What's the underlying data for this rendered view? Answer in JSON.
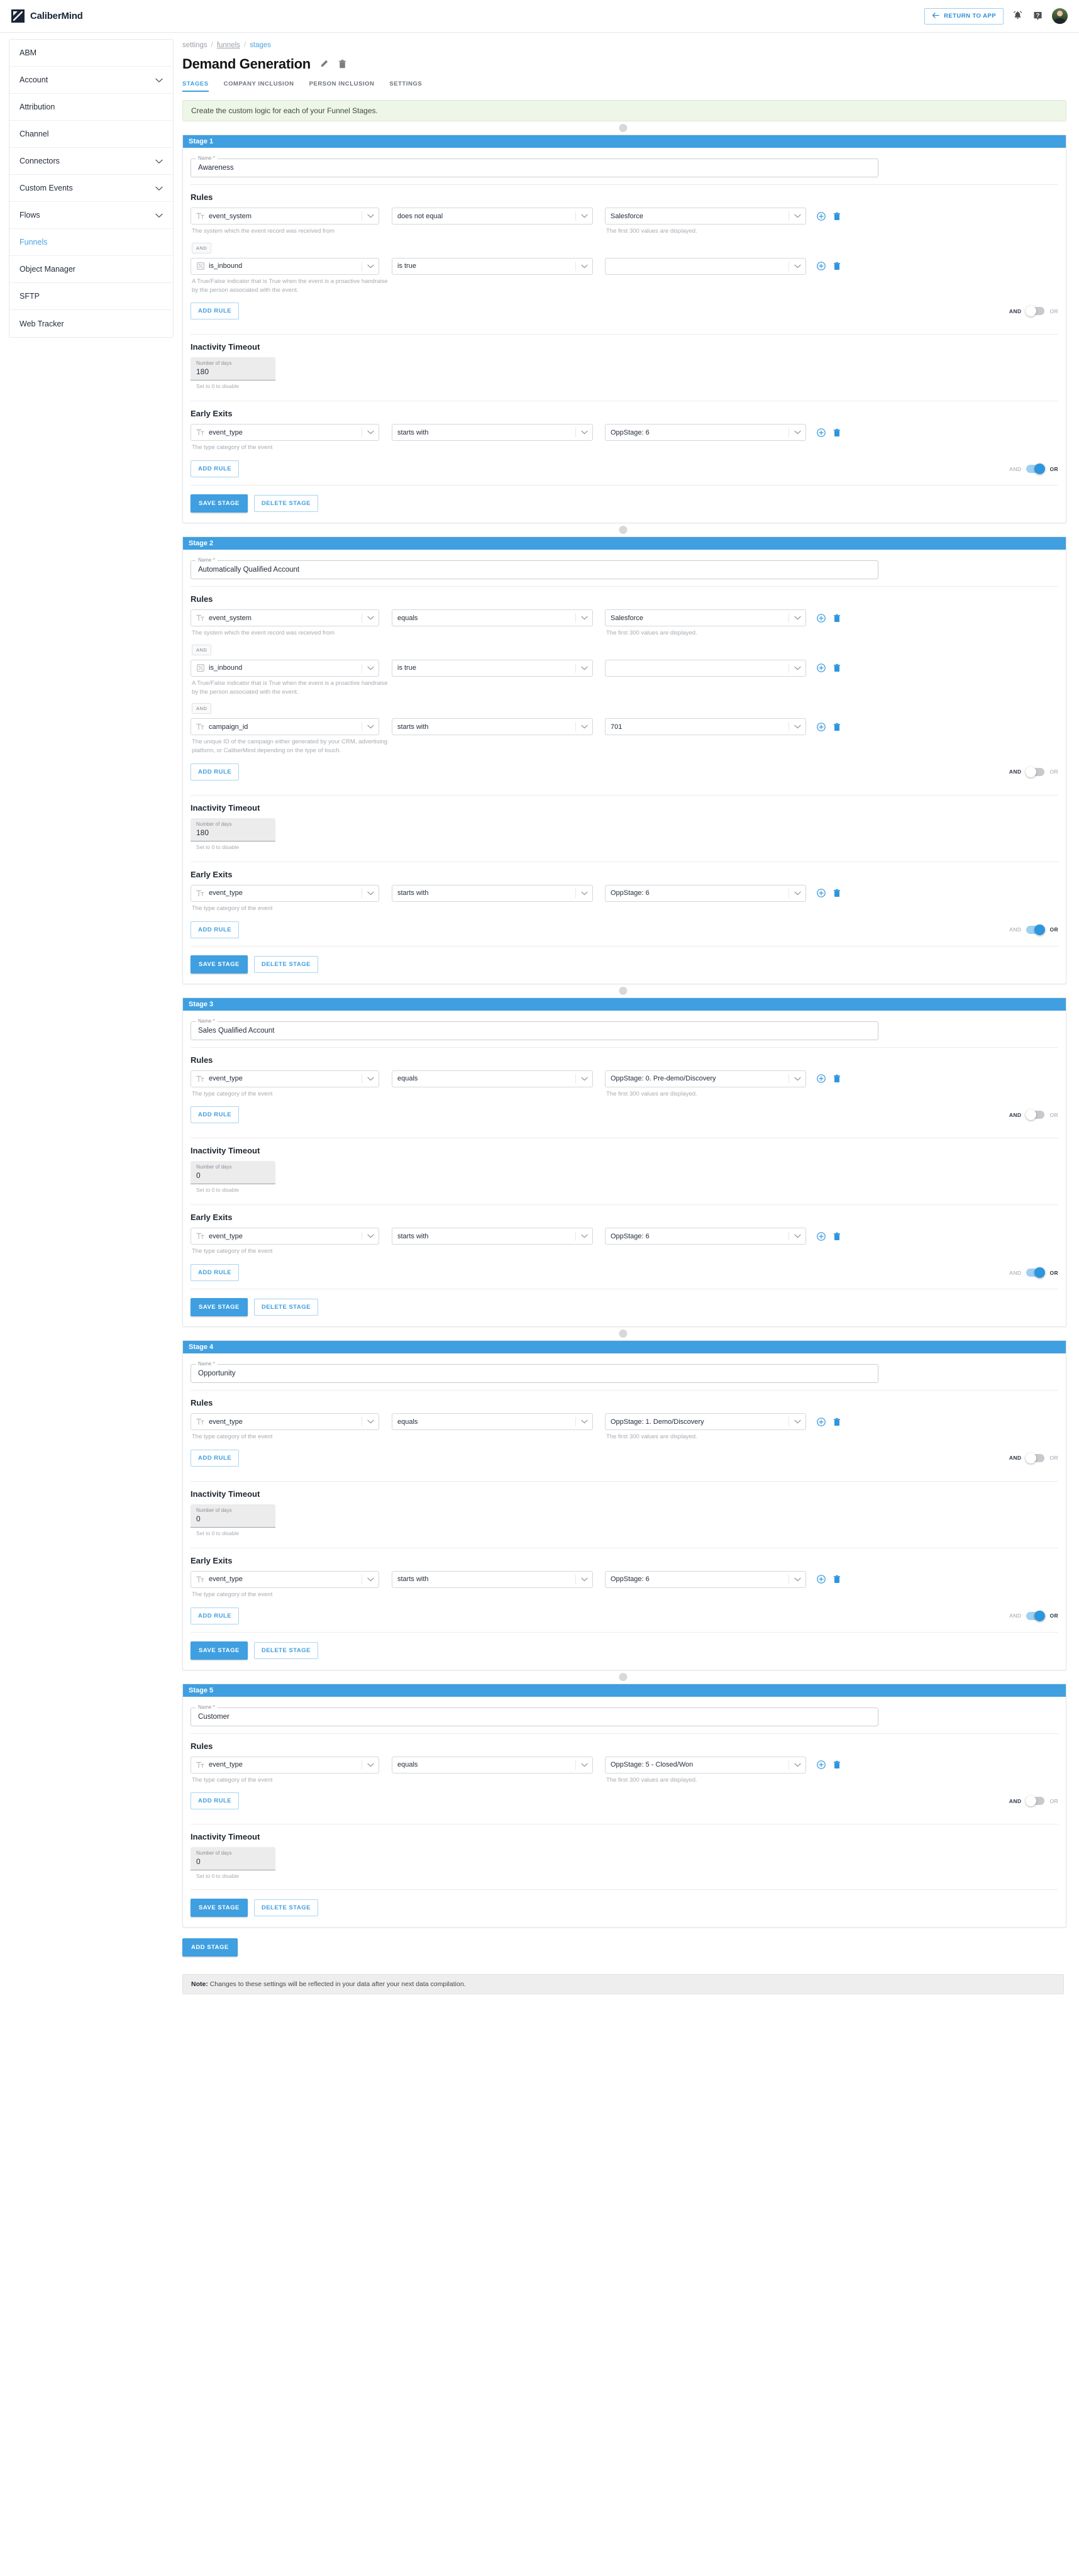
{
  "topbar": {
    "brand": "CaliberMind",
    "return_label": "RETURN TO APP",
    "return_icon": "arrow-left-icon",
    "bell_icon": "notification-bell-icon",
    "help_icon": "help-question-icon",
    "avatar_label": "user-avatar"
  },
  "sidebar": {
    "items": [
      {
        "label": "ABM",
        "expandable": false,
        "active": false
      },
      {
        "label": "Account",
        "expandable": true,
        "active": false
      },
      {
        "label": "Attribution",
        "expandable": false,
        "active": false
      },
      {
        "label": "Channel",
        "expandable": false,
        "active": false
      },
      {
        "label": "Connectors",
        "expandable": true,
        "active": false
      },
      {
        "label": "Custom Events",
        "expandable": true,
        "active": false
      },
      {
        "label": "Flows",
        "expandable": true,
        "active": false
      },
      {
        "label": "Funnels",
        "expandable": false,
        "active": true
      },
      {
        "label": "Object Manager",
        "expandable": false,
        "active": false
      },
      {
        "label": "SFTP",
        "expandable": false,
        "active": false
      },
      {
        "label": "Web Tracker",
        "expandable": false,
        "active": false
      }
    ]
  },
  "breadcrumb": {
    "root": "settings",
    "mid": "funnels",
    "current": "stages",
    "sep": "/"
  },
  "header": {
    "title": "Demand Generation",
    "edit_icon": "pencil-edit-icon",
    "delete_icon": "trash-delete-icon"
  },
  "tabs": [
    {
      "label": "STAGES",
      "active": true
    },
    {
      "label": "COMPANY INCLUSION",
      "active": false
    },
    {
      "label": "PERSON INCLUSION",
      "active": false
    },
    {
      "label": "SETTINGS",
      "active": false
    }
  ],
  "notice": "Create the custom logic for each of your Funnel Stages.",
  "labels": {
    "name_legend": "Name *",
    "rules_title": "Rules",
    "inactivity_title": "Inactivity Timeout",
    "early_exits_title": "Early Exits",
    "add_rule": "ADD RULE",
    "save_stage": "SAVE STAGE",
    "delete_stage": "DELETE STAGE",
    "add_stage": "ADD STAGE",
    "and": "AND",
    "or": "OR",
    "and_chip": "AND",
    "days_label": "Number of days",
    "days_hint": "Set to 0 to disable",
    "value_hint": "The first 300 values are displayed."
  },
  "hints": {
    "event_system": "The system which the event record was received from",
    "is_inbound": "A True/False indicator that is True when the event is a proactive handraise by the person associated with the event.",
    "campaign_id": "The unique ID of the campaign either generated by your CRM, advertising platform, or CaliberMind depending on the type of touch.",
    "event_type": "The type category of the event"
  },
  "footer_note": {
    "bold": "Note:",
    "text": " Changes to these settings will be reflected in your data after your next data compilation."
  },
  "stages": [
    {
      "header": "Stage 1",
      "name": "Awareness",
      "rules": [
        {
          "field": "event_system",
          "field_icon": "text-type-icon",
          "operator": "does not equal",
          "value": "Salesforce",
          "hint": "event_system",
          "show_value_hint": true
        },
        {
          "field": "is_inbound",
          "field_icon": "boolean-type-icon",
          "operator": "is true",
          "value": "",
          "hint": "is_inbound",
          "show_value_hint": false
        }
      ],
      "rules_conjunction": "AND",
      "inactivity_days": "180",
      "early_exits": [
        {
          "field": "event_type",
          "field_icon": "text-type-icon",
          "operator": "starts with",
          "value": "OppStage: 6",
          "hint": "event_type",
          "show_value_hint": false
        }
      ],
      "early_exits_conjunction": "OR"
    },
    {
      "header": "Stage 2",
      "name": "Automatically Qualified Account",
      "rules": [
        {
          "field": "event_system",
          "field_icon": "text-type-icon",
          "operator": "equals",
          "value": "Salesforce",
          "hint": "event_system",
          "show_value_hint": true
        },
        {
          "field": "is_inbound",
          "field_icon": "boolean-type-icon",
          "operator": "is true",
          "value": "",
          "hint": "is_inbound",
          "show_value_hint": false
        },
        {
          "field": "campaign_id",
          "field_icon": "text-type-icon",
          "operator": "starts with",
          "value": "701",
          "hint": "campaign_id",
          "show_value_hint": false
        }
      ],
      "rules_conjunction": "AND",
      "inactivity_days": "180",
      "early_exits": [
        {
          "field": "event_type",
          "field_icon": "text-type-icon",
          "operator": "starts with",
          "value": "OppStage: 6",
          "hint": "event_type",
          "show_value_hint": false
        }
      ],
      "early_exits_conjunction": "OR"
    },
    {
      "header": "Stage 3",
      "name": "Sales Qualified Account",
      "rules": [
        {
          "field": "event_type",
          "field_icon": "text-type-icon",
          "operator": "equals",
          "value": "OppStage: 0. Pre-demo/Discovery",
          "hint": "event_type",
          "show_value_hint": true
        }
      ],
      "rules_conjunction": "AND",
      "inactivity_days": "0",
      "early_exits": [
        {
          "field": "event_type",
          "field_icon": "text-type-icon",
          "operator": "starts with",
          "value": "OppStage: 6",
          "hint": "event_type",
          "show_value_hint": false
        }
      ],
      "early_exits_conjunction": "OR"
    },
    {
      "header": "Stage 4",
      "name": "Opportunity",
      "rules": [
        {
          "field": "event_type",
          "field_icon": "text-type-icon",
          "operator": "equals",
          "value": "OppStage: 1. Demo/Discovery",
          "hint": "event_type",
          "show_value_hint": true
        }
      ],
      "rules_conjunction": "AND",
      "inactivity_days": "0",
      "early_exits": [
        {
          "field": "event_type",
          "field_icon": "text-type-icon",
          "operator": "starts with",
          "value": "OppStage: 6",
          "hint": "event_type",
          "show_value_hint": false
        }
      ],
      "early_exits_conjunction": "OR"
    },
    {
      "header": "Stage 5",
      "name": "Customer",
      "rules": [
        {
          "field": "event_type",
          "field_icon": "text-type-icon",
          "operator": "equals",
          "value": "OppStage: 5 - Closed/Won",
          "hint": "event_type",
          "show_value_hint": true
        }
      ],
      "rules_conjunction": "AND",
      "inactivity_days": "0",
      "early_exits": [],
      "early_exits_conjunction": "AND"
    }
  ],
  "colors": {
    "accent": "#3f9fe0",
    "stage_header": "#3f9fe0",
    "notice_bg": "#eef6e8"
  }
}
